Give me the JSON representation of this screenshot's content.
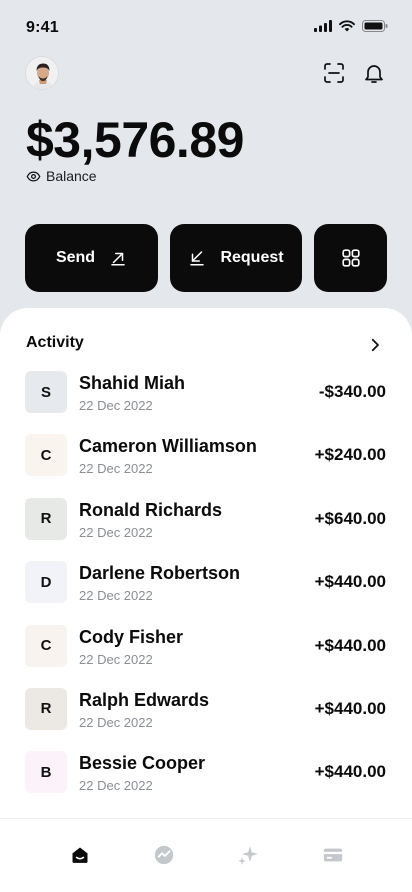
{
  "status_bar": {
    "time": "9:41"
  },
  "balance": {
    "amount": "$3,576.89",
    "label": "Balance"
  },
  "actions": {
    "send": "Send",
    "request": "Request"
  },
  "activity": {
    "title": "Activity",
    "transactions": [
      {
        "initial": "S",
        "name": "Shahid Miah",
        "date": "22 Dec 2022",
        "amount": "-$340.00",
        "tint": "#e6e9ee"
      },
      {
        "initial": "C",
        "name": "Cameron Williamson",
        "date": "22 Dec 2022",
        "amount": "+$240.00",
        "tint": "#faf4ef"
      },
      {
        "initial": "R",
        "name": "Ronald Richards",
        "date": "22 Dec 2022",
        "amount": "+$640.00",
        "tint": "#e6e9e6"
      },
      {
        "initial": "D",
        "name": "Darlene Robertson",
        "date": "22 Dec 2022",
        "amount": "+$440.00",
        "tint": "#f1f3f9"
      },
      {
        "initial": "C",
        "name": "Cody Fisher",
        "date": "22 Dec 2022",
        "amount": "+$440.00",
        "tint": "#f8f3ef"
      },
      {
        "initial": "R",
        "name": "Ralph Edwards",
        "date": "22 Dec 2022",
        "amount": "+$440.00",
        "tint": "#ece9e4"
      },
      {
        "initial": "B",
        "name": "Bessie Cooper",
        "date": "22 Dec 2022",
        "amount": "+$440.00",
        "tint": "#fbf3f9"
      }
    ]
  },
  "tab_bar": {
    "items": [
      {
        "icon": "home-icon",
        "active": true
      },
      {
        "icon": "stats-icon",
        "active": false
      },
      {
        "icon": "sparkle-icon",
        "active": false
      },
      {
        "icon": "card-icon",
        "active": false
      }
    ]
  },
  "colors": {
    "page_bg": "#e4e7ec",
    "button_bg": "#0b0b0c",
    "inactive_icon": "#c4c7cc"
  }
}
